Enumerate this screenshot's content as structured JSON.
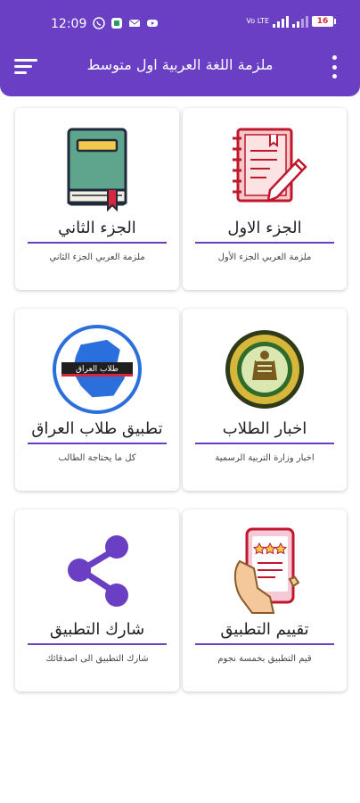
{
  "status": {
    "time": "12:09",
    "battery": "16",
    "network": "Vo LTE"
  },
  "toolbar": {
    "title": "ملزمة اللغة العربية اول متوسط",
    "menu_icon": "hamburger-menu-icon",
    "more_icon": "more-vert-icon"
  },
  "colors": {
    "primary": "#6a3fc4",
    "card_background": "#ffffff",
    "text": "#222222"
  },
  "cards": [
    {
      "title": "الجزء الاول",
      "subtitle": "ملزمة العربي الجزء الأول",
      "icon": "notebook-pencil-icon"
    },
    {
      "title": "الجزء الثاني",
      "subtitle": "ملزمة العربي الجزء الثاني",
      "icon": "book-icon"
    },
    {
      "title": "اخبار الطلاب",
      "subtitle": "اخبار وزارة التربية الرسمية",
      "icon": "ministry-emblem-icon"
    },
    {
      "title": "تطبيق طلاب العراق",
      "subtitle": "كل ما يحتاجة الطالب",
      "icon": "iraq-students-logo-icon",
      "logo_text": "طلاب العراق"
    },
    {
      "title": "تقييم التطبيق",
      "subtitle": "قيم التطبيق بخمسة نجوم",
      "icon": "rate-app-phone-icon"
    },
    {
      "title": "شارك التطبيق",
      "subtitle": "شارك التطبيق الى اصدقائك",
      "icon": "share-icon"
    }
  ]
}
